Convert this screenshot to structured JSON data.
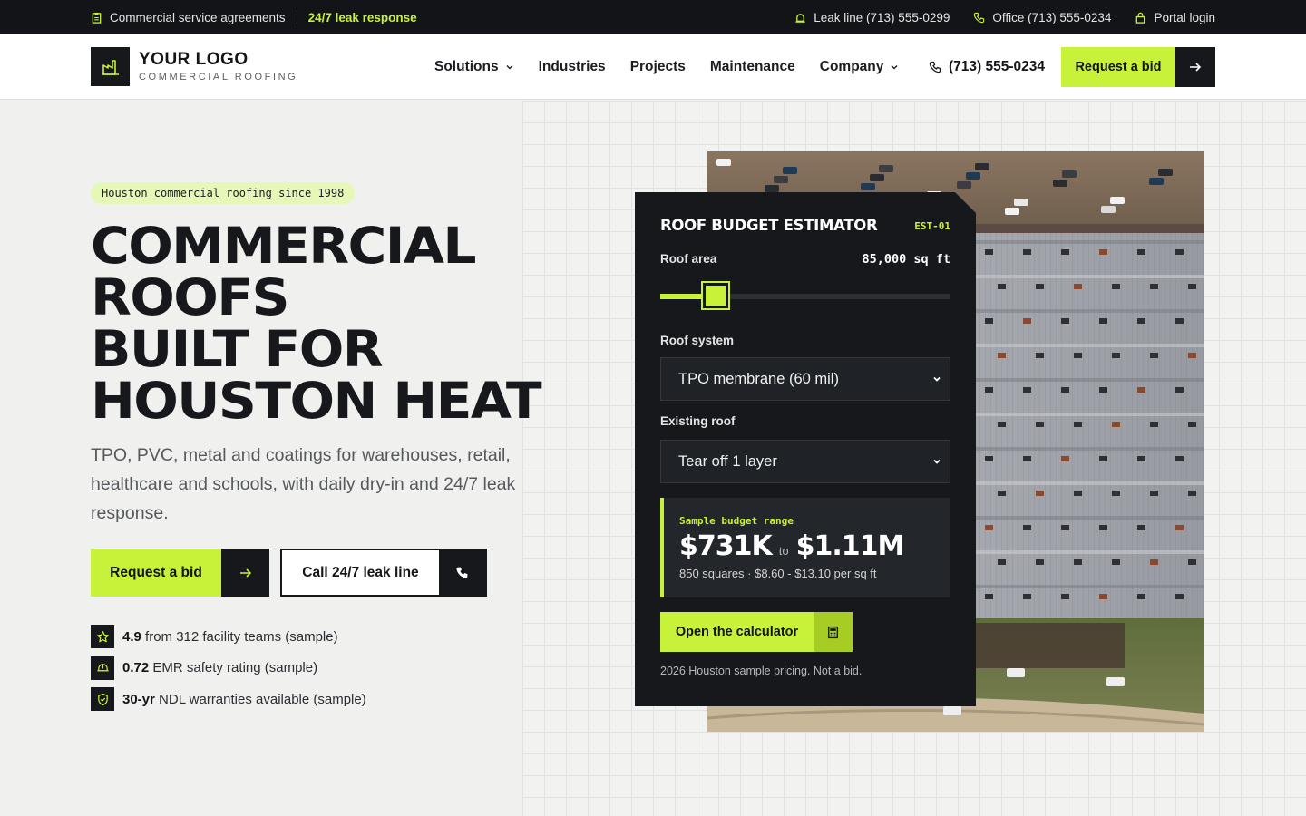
{
  "topbar": {
    "agreements": "Commercial service agreements",
    "leak_response": "24/7 leak response",
    "leak_line": "Leak line  (713) 555-0299",
    "office": "Office (713) 555-0234",
    "portal": "Portal login"
  },
  "brand": {
    "logo_strong": "YOUR LOGO",
    "tagline": "COMMERCIAL ROOFING"
  },
  "nav": {
    "solutions": "Solutions",
    "industries": "Industries",
    "projects": "Projects",
    "maintenance": "Maintenance",
    "company": "Company",
    "phone": "(713) 555-0234",
    "cta": "Request a bid"
  },
  "hero": {
    "badge": "Houston commercial roofing since 1998",
    "headline": [
      "COMMERCIAL",
      "ROOFS",
      "BUILT FOR",
      "HOUSTON HEAT"
    ],
    "lead": "TPO, PVC, metal and coatings for warehouses, retail, healthcare and schools, with daily dry-in and 24/7 leak response.",
    "cta_primary": "Request a bid",
    "cta_secondary": "Call 24/7 leak line",
    "stats": [
      {
        "value": "4.9",
        "text": " from 312 facility teams (sample)",
        "icon": "star-icon"
      },
      {
        "value": "0.72",
        "text": " EMR safety rating (sample)",
        "icon": "hardhat-icon"
      },
      {
        "value": "30-yr",
        "text": " NDL warranties available (sample)",
        "icon": "shield-icon"
      }
    ]
  },
  "estimator": {
    "title": "ROOF BUDGET ESTIMATOR",
    "code": "EST-01",
    "area_label": "Roof area",
    "area_value": "85,000 sq ft",
    "slider_fraction": 0.19,
    "system_label": "Roof system",
    "system_value": "TPO membrane (60 mil)",
    "existing_label": "Existing roof",
    "existing_value": "Tear off 1 layer",
    "result_label": "Sample budget range",
    "result_low": "$731K",
    "result_to": "to",
    "result_high": "$1.11M",
    "result_sub": "850 squares · $8.60 - $13.10 per sq ft",
    "calc_button": "Open the calculator",
    "note": "2026 Houston sample pricing. Not a bid."
  },
  "colors": {
    "accent": "#c8f23a",
    "dark": "#16181b"
  }
}
